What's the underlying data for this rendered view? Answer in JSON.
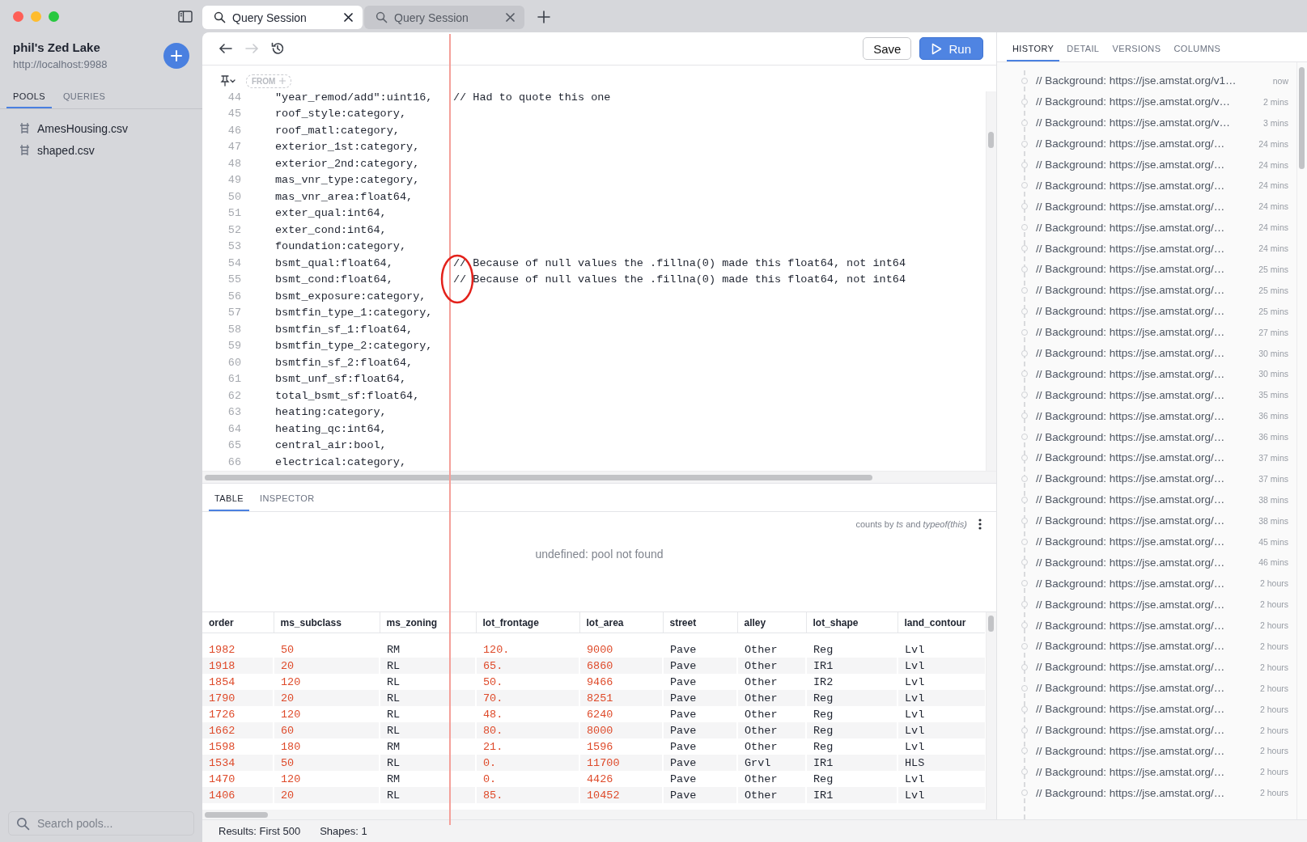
{
  "sidebar": {
    "lake_name": "phil's Zed Lake",
    "url": "http://localhost:9988",
    "tabs": [
      {
        "label": "POOLS",
        "selected": true
      },
      {
        "label": "QUERIES",
        "selected": false
      }
    ],
    "pools": [
      {
        "name": "AmesHousing.csv"
      },
      {
        "name": "shaped.csv"
      }
    ],
    "search": {
      "placeholder": "Search pools..."
    }
  },
  "tabs": [
    {
      "label": "Query Session",
      "selected": true
    },
    {
      "label": "Query Session",
      "selected": false
    }
  ],
  "toolbar": {
    "nav": [
      {
        "kind": "back",
        "disabled": false
      },
      {
        "kind": "forward",
        "disabled": true
      },
      {
        "kind": "history",
        "disabled": false
      }
    ],
    "save": "Save",
    "run": "Run"
  },
  "editor": {
    "from_chip": "FROM",
    "lines": [
      {
        "number": "44",
        "code": "\"year_remod/add\":uint16,",
        "comment": "// Had to quote this one"
      },
      {
        "number": "45",
        "code": "roof_style:category,"
      },
      {
        "number": "46",
        "code": "roof_matl:category,"
      },
      {
        "number": "47",
        "code": "exterior_1st:category,"
      },
      {
        "number": "48",
        "code": "exterior_2nd:category,"
      },
      {
        "number": "49",
        "code": "mas_vnr_type:category,"
      },
      {
        "number": "50",
        "code": "mas_vnr_area:float64,"
      },
      {
        "number": "51",
        "code": "exter_qual:int64,"
      },
      {
        "number": "52",
        "code": "exter_cond:int64,"
      },
      {
        "number": "53",
        "code": "foundation:category,"
      },
      {
        "number": "54",
        "code": "bsmt_qual:float64,",
        "comment": "// Because of null values the .fillna(0) made this float64, not int64"
      },
      {
        "number": "55",
        "code": "bsmt_cond:float64,",
        "comment": "// Because of null values the .fillna(0) made this float64, not int64"
      },
      {
        "number": "56",
        "code": "bsmt_exposure:category,"
      },
      {
        "number": "57",
        "code": "bsmtfin_type_1:category,"
      },
      {
        "number": "58",
        "code": "bsmtfin_sf_1:float64,"
      },
      {
        "number": "59",
        "code": "bsmtfin_type_2:category,"
      },
      {
        "number": "60",
        "code": "bsmtfin_sf_2:float64,"
      },
      {
        "number": "61",
        "code": "bsmt_unf_sf:float64,"
      },
      {
        "number": "62",
        "code": "total_bsmt_sf:float64,"
      },
      {
        "number": "63",
        "code": "heating:category,"
      },
      {
        "number": "64",
        "code": "heating_qc:int64,"
      },
      {
        "number": "65",
        "code": "central_air:bool,"
      },
      {
        "number": "66",
        "code": "electrical:category,"
      }
    ]
  },
  "results": {
    "tabs": [
      {
        "label": "TABLE",
        "selected": true
      },
      {
        "label": "INSPECTOR",
        "selected": false
      }
    ],
    "caption": "counts by *ts* and *typeof(this)*",
    "message": "undefined: pool not found",
    "table": {
      "columns": [
        {
          "label": "order",
          "kind": "number"
        },
        {
          "label": "ms_subclass",
          "kind": "number"
        },
        {
          "label": "ms_zoning",
          "kind": "string"
        },
        {
          "label": "lot_frontage",
          "kind": "number"
        },
        {
          "label": "lot_area",
          "kind": "number"
        },
        {
          "label": "street",
          "kind": "string"
        },
        {
          "label": "alley",
          "kind": "string"
        },
        {
          "label": "lot_shape",
          "kind": "string"
        },
        {
          "label": "land_contour",
          "kind": "string"
        }
      ],
      "rows": [
        [
          "1982",
          "50",
          "RM",
          "120.",
          "9000",
          "Pave",
          "Other",
          "Reg",
          "Lvl"
        ],
        [
          "1918",
          "20",
          "RL",
          "65.",
          "6860",
          "Pave",
          "Other",
          "IR1",
          "Lvl"
        ],
        [
          "1854",
          "120",
          "RL",
          "50.",
          "9466",
          "Pave",
          "Other",
          "IR2",
          "Lvl"
        ],
        [
          "1790",
          "20",
          "RL",
          "70.",
          "8251",
          "Pave",
          "Other",
          "Reg",
          "Lvl"
        ],
        [
          "1726",
          "120",
          "RL",
          "48.",
          "6240",
          "Pave",
          "Other",
          "Reg",
          "Lvl"
        ],
        [
          "1662",
          "60",
          "RL",
          "80.",
          "8000",
          "Pave",
          "Other",
          "Reg",
          "Lvl"
        ],
        [
          "1598",
          "180",
          "RM",
          "21.",
          "1596",
          "Pave",
          "Other",
          "Reg",
          "Lvl"
        ],
        [
          "1534",
          "50",
          "RL",
          "0.",
          "11700",
          "Pave",
          "Grvl",
          "IR1",
          "HLS"
        ],
        [
          "1470",
          "120",
          "RM",
          "0.",
          "4426",
          "Pave",
          "Other",
          "Reg",
          "Lvl"
        ],
        [
          "1406",
          "20",
          "RL",
          "85.",
          "10452",
          "Pave",
          "Other",
          "IR1",
          "Lvl"
        ]
      ]
    }
  },
  "status_bar": {
    "items": [
      "Results: First 500",
      "Shapes: 1"
    ]
  },
  "history": {
    "tabs": [
      {
        "label": "HISTORY",
        "selected": true
      },
      {
        "label": "DETAIL",
        "selected": false
      },
      {
        "label": "VERSIONS",
        "selected": false
      },
      {
        "label": "COLUMNS",
        "selected": false
      }
    ],
    "items": [
      {
        "text": "// Background: https://jse.amstat.org/v1…",
        "time": "now"
      },
      {
        "text": "// Background: https://jse.amstat.org/v…",
        "time": "2 mins"
      },
      {
        "text": "// Background: https://jse.amstat.org/v…",
        "time": "3 mins"
      },
      {
        "text": "// Background: https://jse.amstat.org/…",
        "time": "24 mins"
      },
      {
        "text": "// Background: https://jse.amstat.org/…",
        "time": "24 mins"
      },
      {
        "text": "// Background: https://jse.amstat.org/…",
        "time": "24 mins"
      },
      {
        "text": "// Background: https://jse.amstat.org/…",
        "time": "24 mins"
      },
      {
        "text": "// Background: https://jse.amstat.org/…",
        "time": "24 mins"
      },
      {
        "text": "// Background: https://jse.amstat.org/…",
        "time": "24 mins"
      },
      {
        "text": "// Background: https://jse.amstat.org/…",
        "time": "25 mins"
      },
      {
        "text": "// Background: https://jse.amstat.org/…",
        "time": "25 mins"
      },
      {
        "text": "// Background: https://jse.amstat.org/…",
        "time": "25 mins"
      },
      {
        "text": "// Background: https://jse.amstat.org/…",
        "time": "27 mins"
      },
      {
        "text": "// Background: https://jse.amstat.org/…",
        "time": "30 mins"
      },
      {
        "text": "// Background: https://jse.amstat.org/…",
        "time": "30 mins"
      },
      {
        "text": "// Background: https://jse.amstat.org/…",
        "time": "35 mins"
      },
      {
        "text": "// Background: https://jse.amstat.org/…",
        "time": "36 mins"
      },
      {
        "text": "// Background: https://jse.amstat.org/…",
        "time": "36 mins"
      },
      {
        "text": "// Background: https://jse.amstat.org/…",
        "time": "37 mins"
      },
      {
        "text": "// Background: https://jse.amstat.org/…",
        "time": "37 mins"
      },
      {
        "text": "// Background: https://jse.amstat.org/…",
        "time": "38 mins"
      },
      {
        "text": "// Background: https://jse.amstat.org/…",
        "time": "38 mins"
      },
      {
        "text": "// Background: https://jse.amstat.org/…",
        "time": "45 mins"
      },
      {
        "text": "// Background: https://jse.amstat.org/…",
        "time": "46 mins"
      },
      {
        "text": "// Background: https://jse.amstat.org/…",
        "time": "2 hours"
      },
      {
        "text": "// Background: https://jse.amstat.org/…",
        "time": "2 hours"
      },
      {
        "text": "// Background: https://jse.amstat.org/…",
        "time": "2 hours"
      },
      {
        "text": "// Background: https://jse.amstat.org/…",
        "time": "2 hours"
      },
      {
        "text": "// Background: https://jse.amstat.org/…",
        "time": "2 hours"
      },
      {
        "text": "// Background: https://jse.amstat.org/…",
        "time": "2 hours"
      },
      {
        "text": "// Background: https://jse.amstat.org/…",
        "time": "2 hours"
      },
      {
        "text": "// Background: https://jse.amstat.org/…",
        "time": "2 hours"
      },
      {
        "text": "// Background: https://jse.amstat.org/…",
        "time": "2 hours"
      },
      {
        "text": "// Background: https://jse.amstat.org/…",
        "time": "2 hours"
      },
      {
        "text": "// Background: https://jse.amstat.org/…",
        "time": "2 hours"
      }
    ]
  }
}
